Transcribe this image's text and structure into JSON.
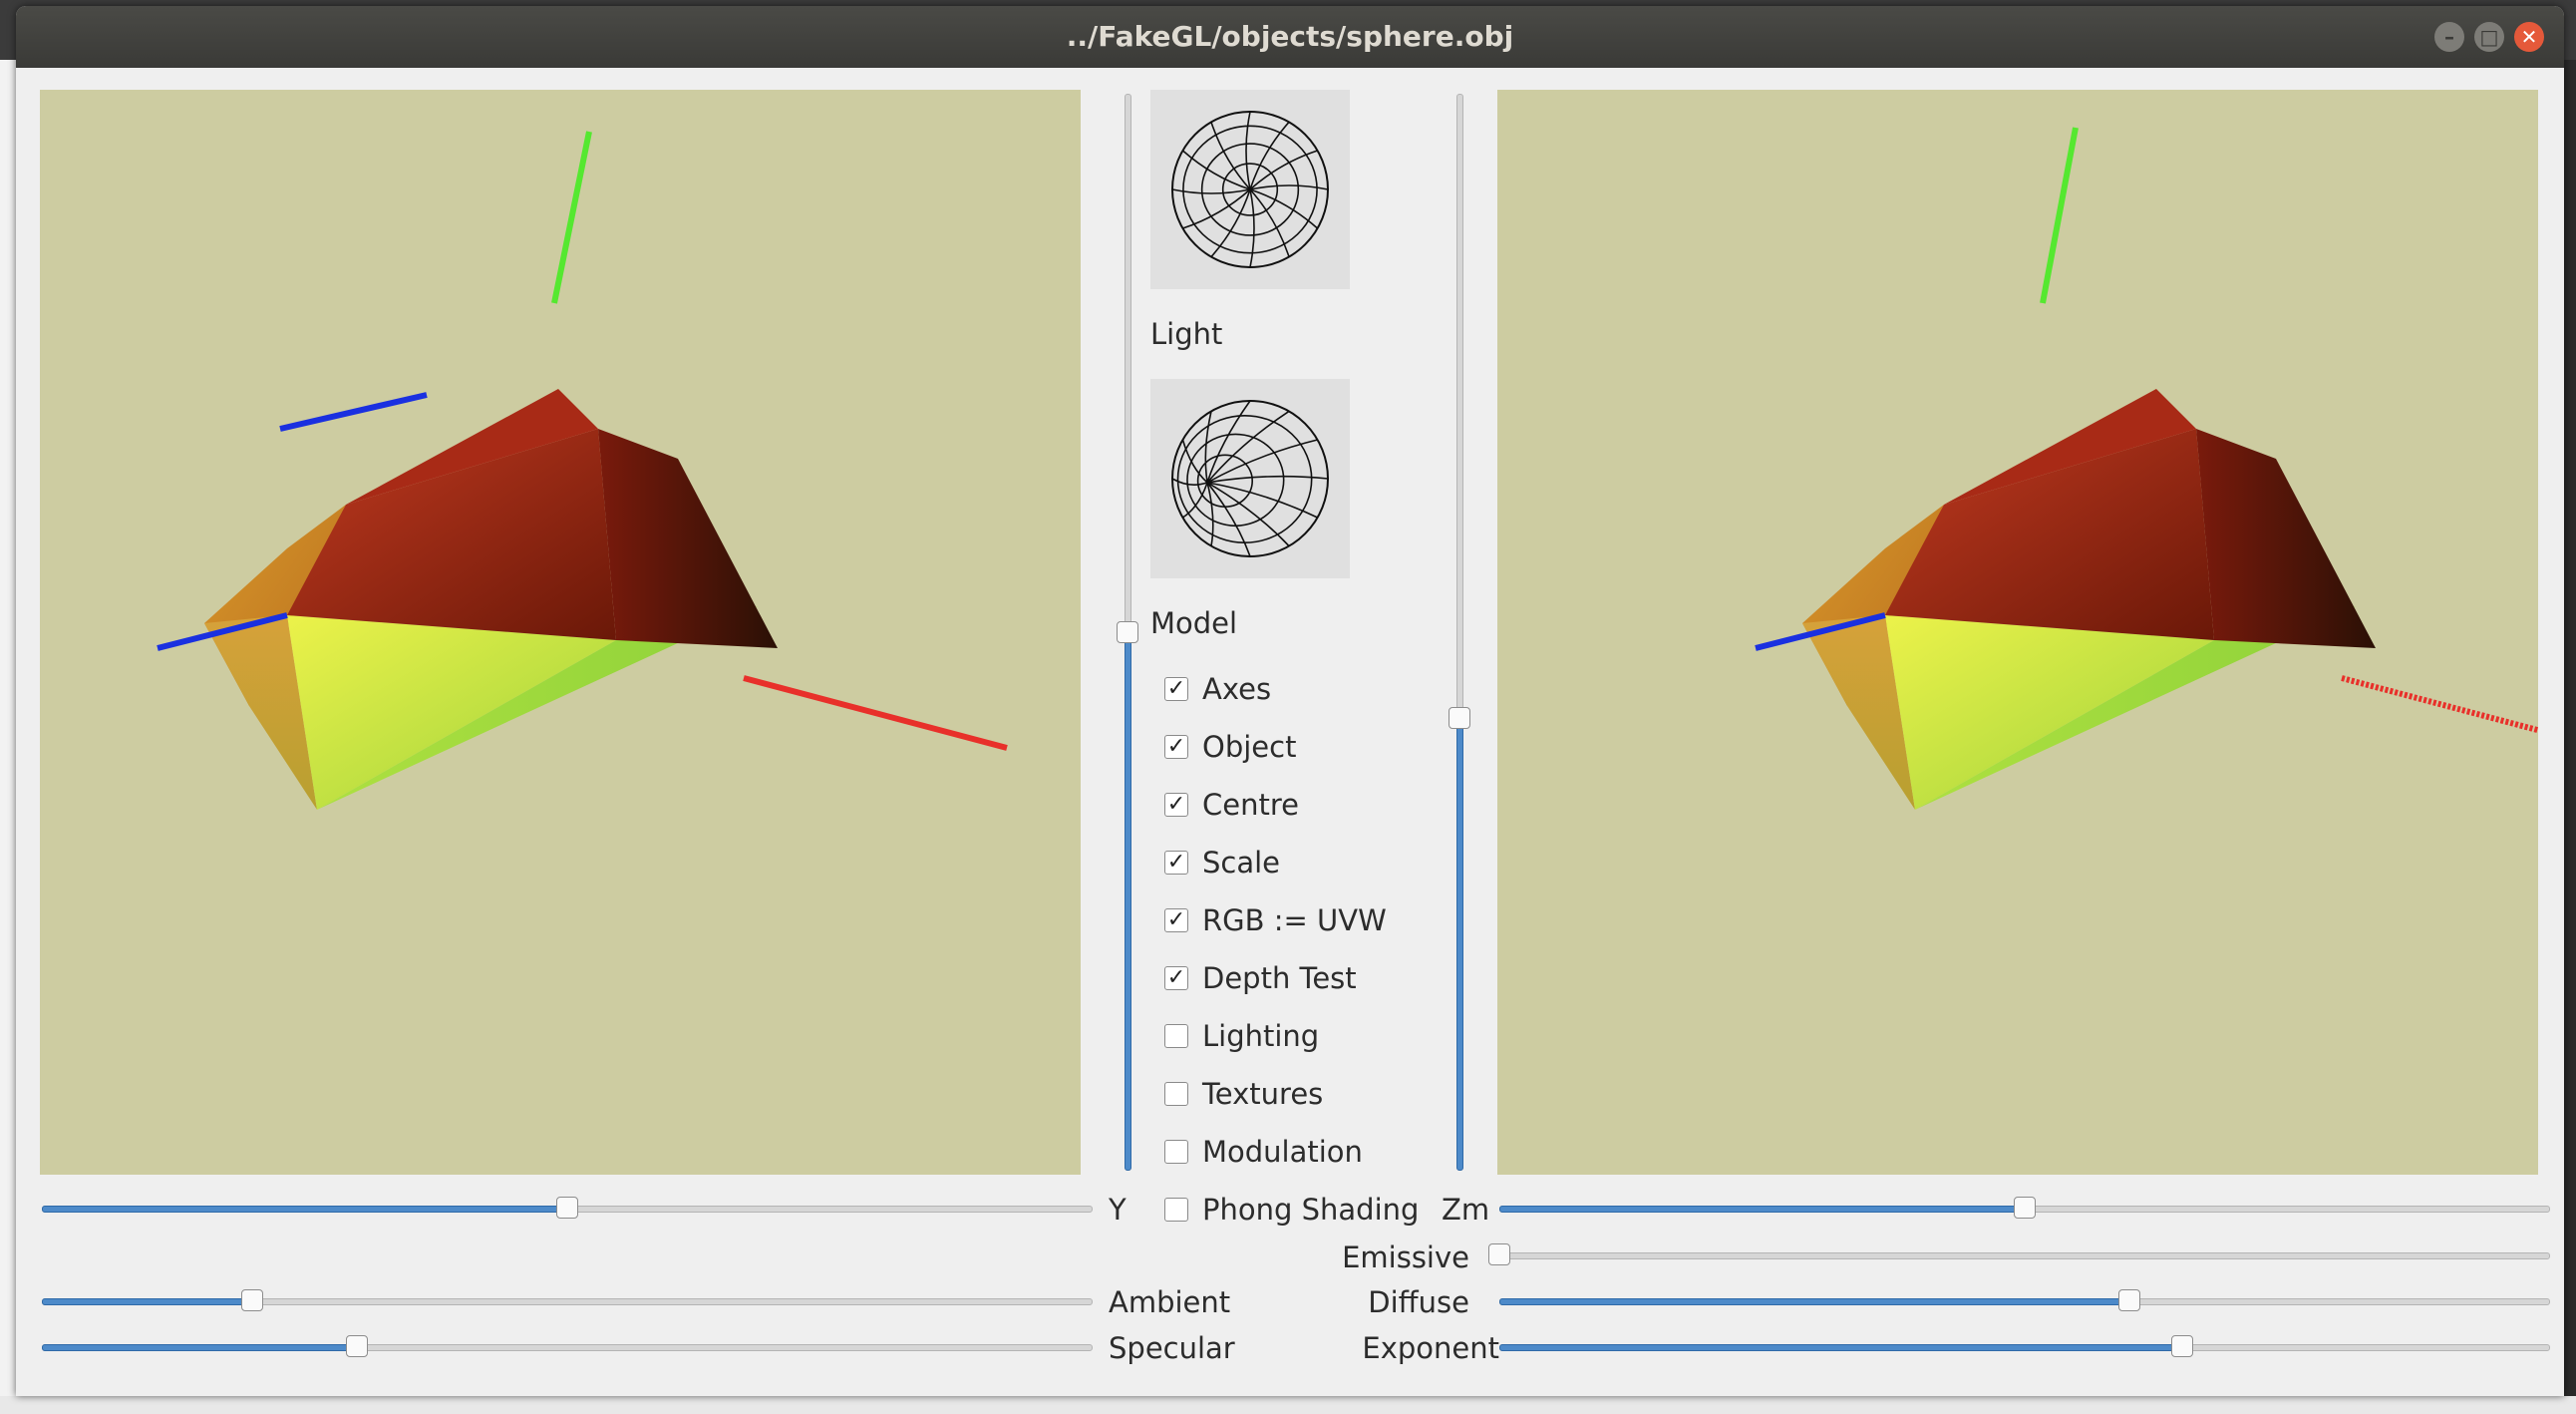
{
  "window": {
    "title": "../FakeGL/objects/sphere.obj",
    "minimize_glyph": "–",
    "maximize_glyph": "□",
    "close_glyph": "✕"
  },
  "panel": {
    "light_label": "Light",
    "model_label": "Model"
  },
  "checkboxes": [
    {
      "label": "Axes",
      "checked": true
    },
    {
      "label": "Object",
      "checked": true
    },
    {
      "label": "Centre",
      "checked": true
    },
    {
      "label": "Scale",
      "checked": true
    },
    {
      "label": "RGB := UVW",
      "checked": true
    },
    {
      "label": "Depth Test",
      "checked": true
    },
    {
      "label": "Lighting",
      "checked": false
    },
    {
      "label": "Textures",
      "checked": false
    },
    {
      "label": "Modulation",
      "checked": false
    },
    {
      "label": "Phong Shading",
      "checked": false
    }
  ],
  "sliders": {
    "y": {
      "label": "Y",
      "value": 0.5
    },
    "zm": {
      "label": "Zm",
      "value": 0.5
    },
    "ambient": {
      "label": "Ambient",
      "value": 0.2
    },
    "specular": {
      "label": "Specular",
      "value": 0.3
    },
    "emissive": {
      "label": "Emissive",
      "value": 0.0
    },
    "diffuse": {
      "label": "Diffuse",
      "value": 0.6
    },
    "exponent": {
      "label": "Exponent",
      "value": 0.65
    },
    "x_rotation": {
      "value": 0.5
    },
    "z_rotation": {
      "value": 0.42
    }
  },
  "colors": {
    "viewport_bg": "#cdcca1",
    "axis_x": "#e8302a",
    "axis_y": "#55e830",
    "axis_z": "#1a30e0",
    "slider_fill": "#4d8ac9"
  }
}
